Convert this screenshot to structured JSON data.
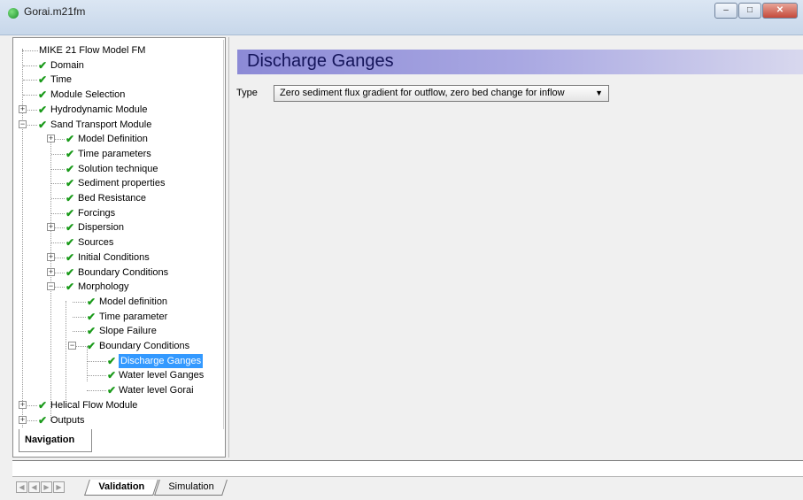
{
  "window": {
    "title": "Gorai.m21fm",
    "buttons": [
      "minimize",
      "maximize",
      "close"
    ]
  },
  "tree": {
    "items": [
      {
        "label": "MIKE 21 Flow Model FM",
        "check": false
      },
      {
        "label": "Domain",
        "check": true
      },
      {
        "label": "Time",
        "check": true
      },
      {
        "label": "Module Selection",
        "check": true
      },
      {
        "label": "Hydrodynamic Module",
        "check": true
      },
      {
        "label": "Sand Transport Module",
        "check": true
      },
      {
        "label": "Model Definition",
        "check": true
      },
      {
        "label": "Time parameters",
        "check": true
      },
      {
        "label": "Solution technique",
        "check": true
      },
      {
        "label": "Sediment properties",
        "check": true
      },
      {
        "label": "Bed Resistance",
        "check": true
      },
      {
        "label": "Forcings",
        "check": true
      },
      {
        "label": "Dispersion",
        "check": true
      },
      {
        "label": "Sources",
        "check": true
      },
      {
        "label": "Initial Conditions",
        "check": true
      },
      {
        "label": "Boundary Conditions",
        "check": true
      },
      {
        "label": "Morphology",
        "check": true
      },
      {
        "label": "Model definition",
        "check": true
      },
      {
        "label": "Time parameter",
        "check": true
      },
      {
        "label": "Slope Failure",
        "check": true
      },
      {
        "label": "Boundary Conditions",
        "check": true
      },
      {
        "label": "Discharge Ganges",
        "check": true,
        "selected": true
      },
      {
        "label": "Water level Ganges",
        "check": true
      },
      {
        "label": "Water level Gorai",
        "check": true
      },
      {
        "label": "Helical Flow Module",
        "check": true
      },
      {
        "label": "Outputs",
        "check": true
      }
    ],
    "nav_tab": "Navigation"
  },
  "main": {
    "heading": "Discharge Ganges",
    "type_label": "Type",
    "type_value": "Zero sediment flux gradient for outflow, zero bed change for inflow"
  },
  "bottom": {
    "tabs": [
      "Validation",
      "Simulation"
    ],
    "active_tab": "Validation"
  },
  "colors": {
    "selection": "#3399ff",
    "check": "#1a9a1a",
    "banner_start": "#8c8ad6",
    "banner_end": "#d8d8ee"
  }
}
